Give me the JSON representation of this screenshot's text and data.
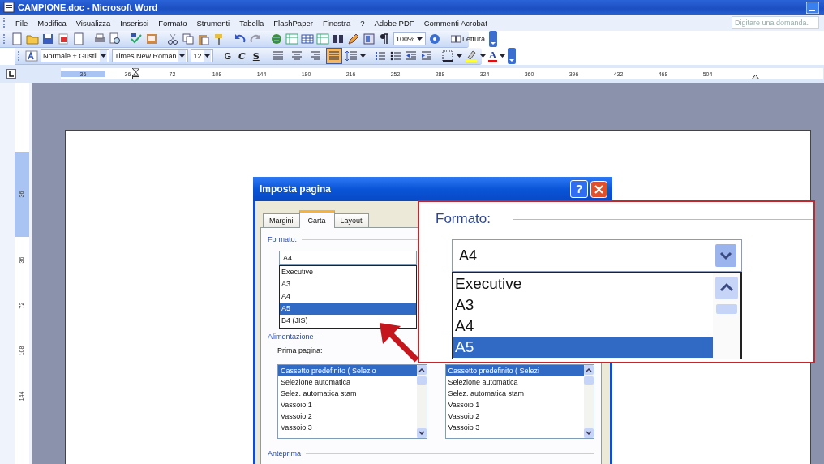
{
  "window": {
    "title": "CAMPIONE.doc - Microsoft Word"
  },
  "menu": [
    {
      "label": "File"
    },
    {
      "label": "Modifica"
    },
    {
      "label": "Visualizza"
    },
    {
      "label": "Inserisci"
    },
    {
      "label": "Formato"
    },
    {
      "label": "Strumenti"
    },
    {
      "label": "Tabella"
    },
    {
      "label": "FlashPaper"
    },
    {
      "label": "Finestra"
    },
    {
      "label": "?"
    },
    {
      "label": "Adobe PDF"
    },
    {
      "label": "Commenti Acrobat"
    }
  ],
  "help_field": {
    "placeholder": "Digitare una domanda."
  },
  "standard_toolbar": {
    "zoom": "100%",
    "reading_button": "Lettura"
  },
  "formatting_toolbar": {
    "style": "Normale + Gustil",
    "font": "Times New Roman",
    "size": "12",
    "text_buttons": [
      {
        "label": "G",
        "kind": "bold"
      },
      {
        "label": "C",
        "kind": "italic"
      },
      {
        "label": "S",
        "kind": "underline"
      }
    ],
    "alignment": [
      {
        "selected": false
      },
      {
        "selected": false
      },
      {
        "selected": false
      },
      {
        "selected": true
      }
    ],
    "font_color_button": "A"
  },
  "ruler": {
    "horizontal_labels": [
      "36",
      "36",
      "72",
      "108",
      "144",
      "180",
      "216",
      "252",
      "288",
      "324",
      "360",
      "396",
      "432",
      "468",
      "504"
    ],
    "vertical_labels": [
      "36",
      "36",
      "72",
      "108",
      "144"
    ]
  },
  "dialog": {
    "title": "Imposta pagina",
    "help_button": "?",
    "tabs": [
      {
        "label": "Margini",
        "selected": false
      },
      {
        "label": "Carta",
        "selected": true
      },
      {
        "label": "Layout",
        "selected": false
      }
    ],
    "format_label": "Formato:",
    "format_value": "A4",
    "format_options": [
      {
        "label": "Executive",
        "selected": false
      },
      {
        "label": "A3",
        "selected": false
      },
      {
        "label": "A4",
        "selected": false
      },
      {
        "label": "A5",
        "selected": true
      },
      {
        "label": "B4 (JIS)",
        "selected": false
      }
    ],
    "feed_label": "Alimentazione",
    "first_page_label": "Prima pagina:",
    "first_page_options": [
      {
        "label": "Cassetto predefinito ( Selezio",
        "selected": true
      },
      {
        "label": "Selezione automatica",
        "selected": false
      },
      {
        "label": "Selez. automatica stam",
        "selected": false
      },
      {
        "label": "Vassoio 1",
        "selected": false
      },
      {
        "label": "Vassoio 2",
        "selected": false
      },
      {
        "label": "Vassoio 3",
        "selected": false
      }
    ],
    "other_pages_options": [
      {
        "label": "Cassetto predefinito ( Selezi",
        "selected": true
      },
      {
        "label": "Selezione automatica",
        "selected": false
      },
      {
        "label": "Selez. automatica stam",
        "selected": false
      },
      {
        "label": "Vassoio 1",
        "selected": false
      },
      {
        "label": "Vassoio 2",
        "selected": false
      },
      {
        "label": "Vassoio 3",
        "selected": false
      }
    ],
    "preview_label": "Anteprima"
  },
  "callout": {
    "format_label": "Formato:",
    "format_value": "A4",
    "format_options": [
      {
        "label": "Executive",
        "selected": false
      },
      {
        "label": "A3",
        "selected": false
      },
      {
        "label": "A4",
        "selected": false
      },
      {
        "label": "A5",
        "selected": true
      }
    ]
  }
}
